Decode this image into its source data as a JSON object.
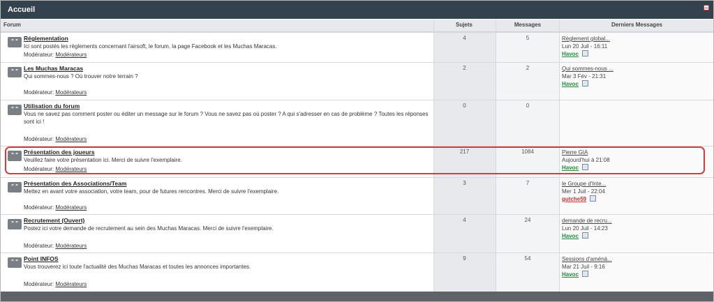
{
  "header": {
    "title": "Accueil"
  },
  "columns": {
    "forum": "Forum",
    "sujets": "Sujets",
    "messages": "Messages",
    "last": "Derniers Messages"
  },
  "forums": [
    {
      "name": "Réglementation",
      "description": "Ici sont postés les règlements concernant l'airsoft, le forum, la page Facebook et les Muchas Maracas.",
      "moderator_label": "Modérateur:",
      "moderator_link": "Modérateurs",
      "sujets": "4",
      "messages": "5",
      "last_title": "Règlement global...",
      "last_date": "Lun 20 Juil - 16:11",
      "last_user": "Havoc",
      "last_user_color": "#1f8b3a"
    },
    {
      "name": "Les Muchas Maracas",
      "description": "Qui sommes-nous ? Où trouver notre terrain ?",
      "moderator_label": "Modérateur:",
      "moderator_link": "Modérateurs",
      "sujets": "2",
      "messages": "2",
      "last_title": "Qui sommes-nous ...",
      "last_date": "Mar 3 Fév - 21:31",
      "last_user": "Havoc",
      "last_user_color": "#1f8b3a"
    },
    {
      "name": "Utilisation du forum",
      "description": "Vous ne savez pas comment poster ou éditer un message sur le forum ? Vous ne savez pas où poster ? A qui s'adresser en cas de problème ? Toutes les réponses sont ici !",
      "moderator_label": "Modérateur:",
      "moderator_link": "Modérateurs",
      "sujets": "0",
      "messages": "0",
      "last_title": "",
      "last_date": "",
      "last_user": "",
      "last_user_color": "#1f8b3a"
    },
    {
      "name": "Présentation des joueurs",
      "description": "Veuillez faire votre présentation ici. Merci de suivre l'exemplaire.",
      "moderator_label": "Modérateur:",
      "moderator_link": "Modérateurs",
      "sujets": "217",
      "messages": "1084",
      "last_title": "Pierre GIA",
      "last_date": "Aujourd'hui à 21:08",
      "last_user": "Havoc",
      "last_user_color": "#1f8b3a"
    },
    {
      "name": "Présentation des Associations/Team",
      "description": "Mettez en avant votre association, votre team, pour de futures rencontres. Merci de suivre l'exemplaire.",
      "moderator_label": "Modérateur:",
      "moderator_link": "Modérateurs",
      "sujets": "3",
      "messages": "7",
      "last_title": "le Groupe d'Inte...",
      "last_date": "Mer 1 Juil - 22:04",
      "last_user": "gutche59",
      "last_user_color": "#c33333"
    },
    {
      "name": "Recrutement (Ouvert)",
      "description": "Postez ici votre demande de recrutement au sein des Muchas Maracas. Merci de suivre l'exemplaire.",
      "moderator_label": "Modérateur:",
      "moderator_link": "Modérateurs",
      "sujets": "4",
      "messages": "24",
      "last_title": "demande de recru...",
      "last_date": "Lun 20 Juil - 14:23",
      "last_user": "Havoc",
      "last_user_color": "#1f8b3a"
    },
    {
      "name": "Point INFOS",
      "description": "Vous trouverez ici toute l'actualité des Muchas Maracas et toutes les annonces importantes.",
      "moderator_label": "Modérateur:",
      "moderator_link": "Modérateurs",
      "sujets": "9",
      "messages": "54",
      "last_title": "Sessions d'améná...",
      "last_date": "Mar 21 Juil - 9:16",
      "last_user": "Havoc",
      "last_user_color": "#1f8b3a"
    }
  ]
}
